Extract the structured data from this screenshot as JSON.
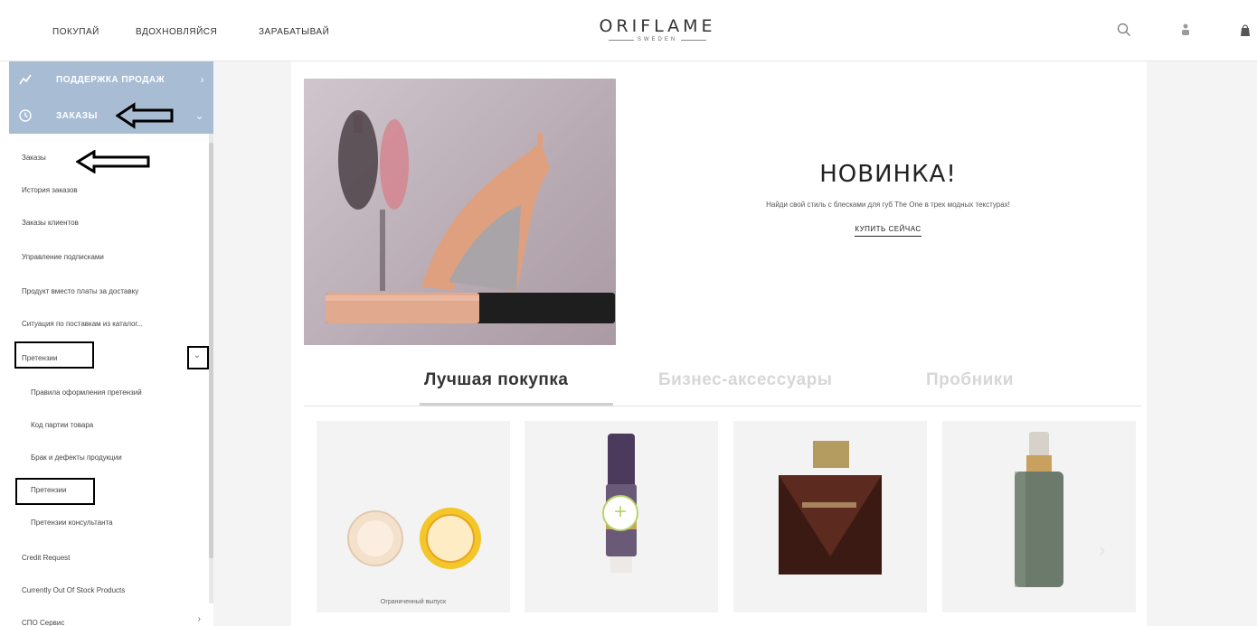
{
  "header": {
    "nav": [
      "ПОКУПАЙ",
      "ВДОХНОВЛЯЙСЯ",
      "ЗАРАБАТЫВАЙ"
    ],
    "logo": "ORIFLAME",
    "logo_sub": "SWEDEN",
    "icons": [
      "search-icon",
      "user-icon",
      "bag-icon"
    ]
  },
  "sidebar": {
    "sections": [
      {
        "label": "ПОДДЕРЖКА ПРОДАЖ",
        "icon": "chart-line-icon",
        "chevron": "chevron-right-icon"
      },
      {
        "label": "ЗАКАЗЫ",
        "icon": "clock-icon",
        "chevron": "chevron-down-icon"
      }
    ],
    "items": [
      "Заказы",
      "История заказов",
      "Заказы клиентов",
      "Управление подписками",
      "Продукт вместо платы за доставку",
      "Ситуация по поставкам из каталог..."
    ],
    "claims_label": "Претензии",
    "claims_sub": [
      "Правила оформления претензий",
      "Код партии товара",
      "Брак и дефекты продукции",
      "Претензии",
      "Претензии консультанта"
    ],
    "after_items": [
      "Credit Request",
      "Currently Out Of Stock Products",
      "СПО Сервис"
    ]
  },
  "hero": {
    "title": "НОВИНКА!",
    "subtitle": "Найди свой стиль с блесками для губ The One в трех модных текстурах!",
    "cta": "КУПИТЬ СЕЙЧАС"
  },
  "tabs": [
    {
      "label": "Лучшая покупка",
      "active": true
    },
    {
      "label": "Бизнес-аксессуары",
      "active": false
    },
    {
      "label": "Пробники",
      "active": false
    }
  ],
  "products": [
    {
      "caption": "Ограниченный выпуск"
    },
    {
      "caption": ""
    },
    {
      "caption": ""
    },
    {
      "caption": ""
    }
  ],
  "colors": {
    "sidebar_header": "#a8bdd4",
    "accent_green": "#b9d36b"
  }
}
